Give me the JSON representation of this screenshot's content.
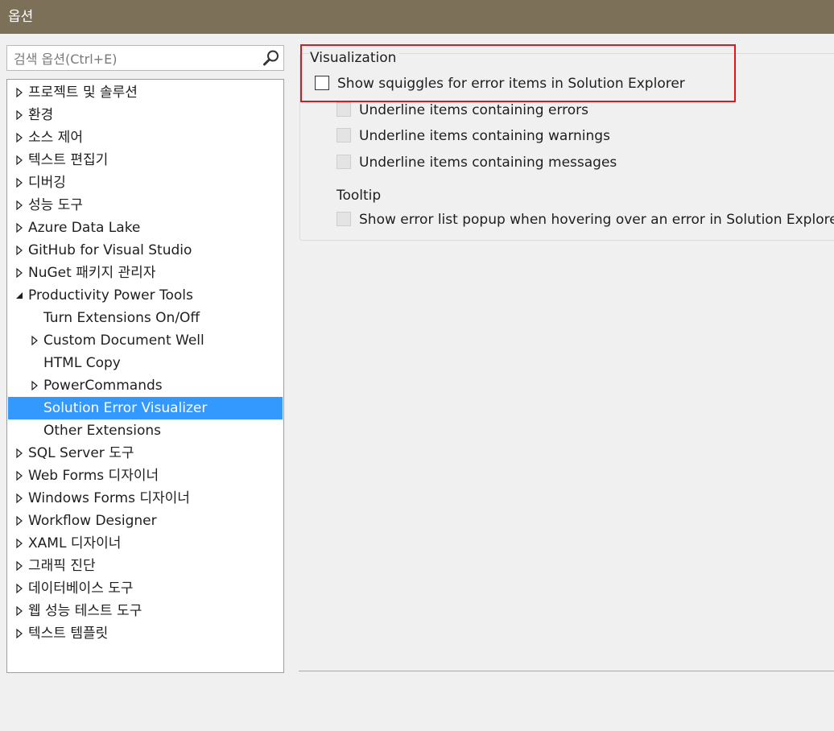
{
  "window": {
    "title": "옵션"
  },
  "search": {
    "placeholder": "검색 옵션(Ctrl+E)",
    "value": ""
  },
  "tree": {
    "items": [
      {
        "label": "프로젝트 및 솔루션",
        "level": 0,
        "expander": "collapsed"
      },
      {
        "label": "환경",
        "level": 0,
        "expander": "collapsed"
      },
      {
        "label": "소스 제어",
        "level": 0,
        "expander": "collapsed"
      },
      {
        "label": "텍스트 편집기",
        "level": 0,
        "expander": "collapsed"
      },
      {
        "label": "디버깅",
        "level": 0,
        "expander": "collapsed"
      },
      {
        "label": "성능 도구",
        "level": 0,
        "expander": "collapsed"
      },
      {
        "label": "Azure Data Lake",
        "level": 0,
        "expander": "collapsed"
      },
      {
        "label": "GitHub for Visual Studio",
        "level": 0,
        "expander": "collapsed"
      },
      {
        "label": "NuGet 패키지 관리자",
        "level": 0,
        "expander": "collapsed"
      },
      {
        "label": "Productivity Power Tools",
        "level": 0,
        "expander": "expanded"
      },
      {
        "label": "Turn Extensions On/Off",
        "level": 1,
        "expander": "none"
      },
      {
        "label": "Custom Document Well",
        "level": 1,
        "expander": "collapsed"
      },
      {
        "label": "HTML Copy",
        "level": 1,
        "expander": "none"
      },
      {
        "label": "PowerCommands",
        "level": 1,
        "expander": "collapsed"
      },
      {
        "label": "Solution Error Visualizer",
        "level": 1,
        "expander": "none",
        "selected": true
      },
      {
        "label": "Other Extensions",
        "level": 1,
        "expander": "none"
      },
      {
        "label": "SQL Server 도구",
        "level": 0,
        "expander": "collapsed"
      },
      {
        "label": "Web Forms 디자이너",
        "level": 0,
        "expander": "collapsed"
      },
      {
        "label": "Windows Forms 디자이너",
        "level": 0,
        "expander": "collapsed"
      },
      {
        "label": "Workflow Designer",
        "level": 0,
        "expander": "collapsed"
      },
      {
        "label": "XAML 디자이너",
        "level": 0,
        "expander": "collapsed"
      },
      {
        "label": "그래픽 진단",
        "level": 0,
        "expander": "collapsed"
      },
      {
        "label": "데이터베이스 도구",
        "level": 0,
        "expander": "collapsed"
      },
      {
        "label": "웹 성능 테스트 도구",
        "level": 0,
        "expander": "collapsed"
      },
      {
        "label": "텍스트 템플릿",
        "level": 0,
        "expander": "collapsed"
      }
    ]
  },
  "panel": {
    "group_title": "Visualization",
    "show_squiggles": {
      "label": "Show squiggles for error items in Solution Explorer",
      "checked": false,
      "enabled": true
    },
    "underline_errors": {
      "label": "Underline items containing errors",
      "checked": false,
      "enabled": false
    },
    "underline_warnings": {
      "label": "Underline items containing warnings",
      "checked": false,
      "enabled": false
    },
    "underline_messages": {
      "label": "Underline items containing messages",
      "checked": false,
      "enabled": false
    },
    "tooltip_heading": "Tooltip",
    "show_popup": {
      "label": "Show error list popup when hovering over an error in Solution Explorer",
      "checked": false,
      "enabled": false
    }
  },
  "colors": {
    "titlebar": "#7c7058",
    "selection": "#3399ff",
    "highlight_box": "#e4141b"
  }
}
